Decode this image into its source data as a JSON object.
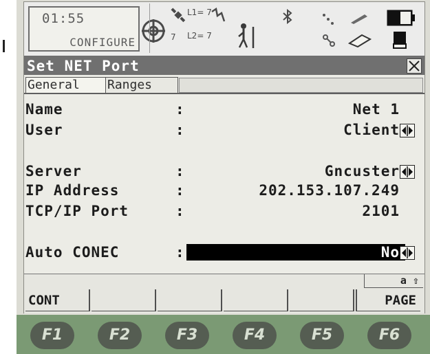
{
  "status": {
    "time": "01:55",
    "mode": "CONFIGURE",
    "l1": "L1= 7",
    "l2": "L2= 7",
    "sat_count": "7",
    "icons": [
      "target-icon",
      "satellite-icon",
      "lightning-icon",
      "walking-person-icon",
      "bluetooth-icon",
      "dots-icon",
      "link-icon",
      "pen-icon",
      "card-icon",
      "battery-icon",
      "memory-icon"
    ]
  },
  "window": {
    "title": "Set NET Port",
    "close_icon": "close-icon"
  },
  "tabs": [
    {
      "label": "General",
      "active": true
    },
    {
      "label": "Ranges",
      "active": false
    }
  ],
  "form": {
    "rows": [
      {
        "label": "Name",
        "colon": ":",
        "value": "Net 1"
      },
      {
        "label": "User",
        "colon": ":",
        "value": "Client"
      },
      {
        "label": "Server",
        "colon": ":",
        "value": "Gncuster"
      },
      {
        "label": "IP Address",
        "colon": ":",
        "value": "202.153.107.249"
      },
      {
        "label": "TCP/IP Port",
        "colon": ":",
        "value": "2101"
      },
      {
        "label": "Auto CONEC",
        "colon": ":",
        "value": "No"
      }
    ]
  },
  "input_mode": "a ⇧",
  "softkeys": {
    "f1": "CONT",
    "f6": "PAGE"
  },
  "fkeys": [
    "F1",
    "F2",
    "F3",
    "F4",
    "F5",
    "F6"
  ],
  "colors": {
    "titlebar": "#707070",
    "fkey_bar": "#7b9a74",
    "fkey_button": "#555d52"
  }
}
